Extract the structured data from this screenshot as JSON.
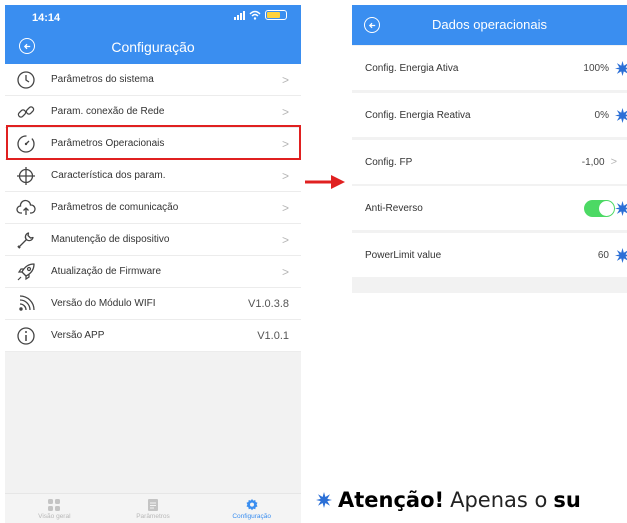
{
  "left_phone": {
    "status": {
      "time": "14:14"
    },
    "title": "Configuração",
    "menu": [
      {
        "label": "Parâmetros do sistema",
        "icon": "clock-icon",
        "value": ""
      },
      {
        "label": "Param. conexão de Rede",
        "icon": "link-icon",
        "value": ""
      },
      {
        "label": "Parâmetros Operacionais",
        "icon": "gauge-icon",
        "value": ""
      },
      {
        "label": "Característica dos param.",
        "icon": "crosshair-icon",
        "value": ""
      },
      {
        "label": "Parâmetros de comunicação",
        "icon": "cloud-upload-icon",
        "value": ""
      },
      {
        "label": "Manutenção de dispositivo",
        "icon": "wrench-icon",
        "value": ""
      },
      {
        "label": "Atualização de Firmware",
        "icon": "rocket-icon",
        "value": ""
      },
      {
        "label": "Versão do Módulo WIFI",
        "icon": "wifi-signal-icon",
        "value": "V1.0.3.8"
      },
      {
        "label": "Versão APP",
        "icon": "info-icon",
        "value": "V1.0.1"
      }
    ],
    "chevron": ">",
    "tabs": [
      {
        "label": "Visão geral",
        "icon": "grid-icon",
        "active": false
      },
      {
        "label": "Parâmetros",
        "icon": "document-icon",
        "active": false
      },
      {
        "label": "Configuração",
        "icon": "gear-icon",
        "active": true
      }
    ],
    "highlighted_item": "Parâmetros Operacionais"
  },
  "right_phone": {
    "title": "Dados operacionais",
    "rows": [
      {
        "label": "Config. Energia Ativa",
        "value": "100%",
        "trailing": "star"
      },
      {
        "label": "Config. Energia Reativa",
        "value": "0%",
        "trailing": "star"
      },
      {
        "label": "Config. FP",
        "value": "-1,00",
        "trailing": "chevron"
      },
      {
        "label": "Anti-Reverso",
        "value": "",
        "trailing": "toggle",
        "toggle_on": true
      },
      {
        "label": "PowerLimit value",
        "value": "60",
        "trailing": "star"
      }
    ],
    "chevron": ">"
  },
  "caption": {
    "bold": "Atenção!",
    "light": "Apenas o",
    "bold_tail": "su"
  },
  "colors": {
    "header_blue": "#3a8ef0",
    "highlight_red": "#e02020",
    "toggle_green": "#4cd964",
    "star_blue": "#2b6fd6"
  }
}
